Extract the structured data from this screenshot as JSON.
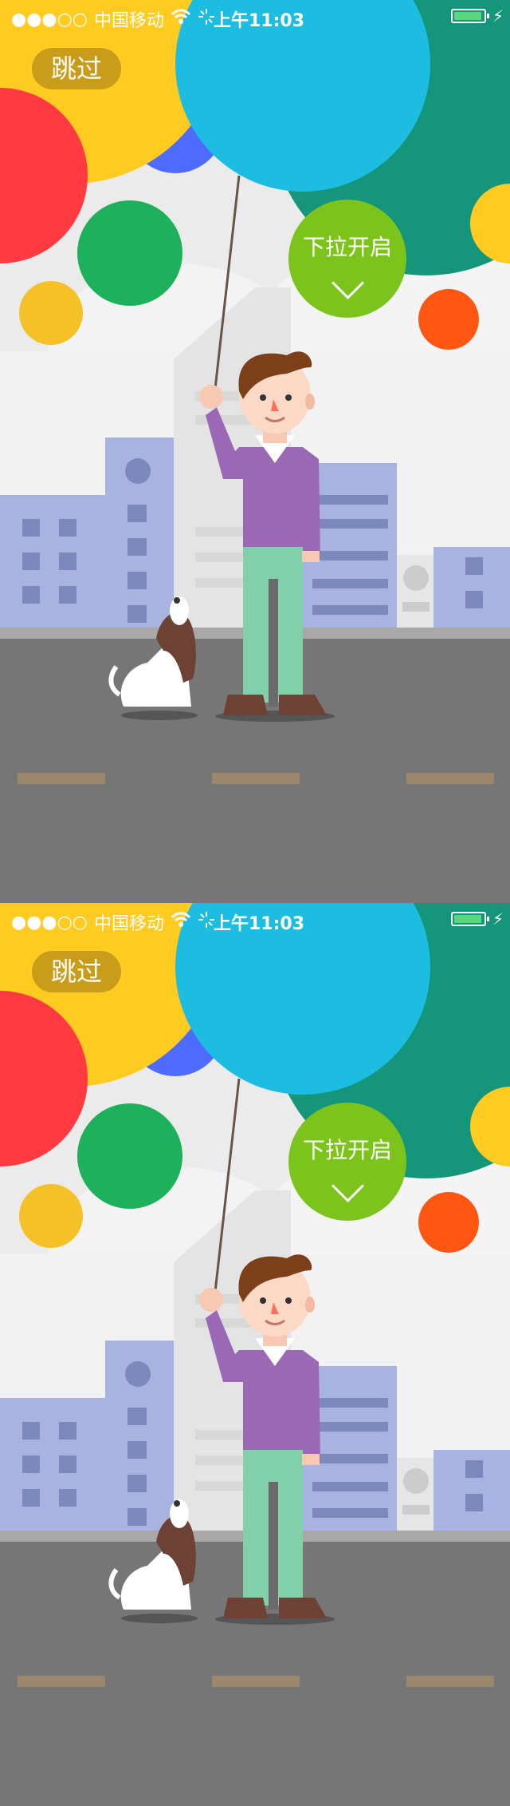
{
  "status_bar": {
    "signal_dots": "●●●○○",
    "carrier": "中国移动",
    "wifi_icon": "wifi-icon",
    "activity_icon": "activity-spinner-icon",
    "time": "上午11:03",
    "battery_level": 0.95,
    "charging_icon": "charging-bolt-icon"
  },
  "screens": [
    {
      "skip_label": "跳过",
      "pull_label": "下拉开启",
      "pull_icon": "chevron-down-icon"
    },
    {
      "skip_label": "跳过",
      "pull_label": "下拉开启",
      "pull_icon": "chevron-down-icon"
    }
  ],
  "colors": {
    "sky": "#e9e9e9",
    "yellow": "#ffcb21",
    "red": "#ff3a40",
    "blue": "#4d6cff",
    "cyan": "#1dbde2",
    "teal": "#15967a",
    "green": "#1cb15a",
    "lime": "#7cc41b",
    "orange": "#ff5712",
    "road": "#767676",
    "building": "#a9b3e0"
  }
}
